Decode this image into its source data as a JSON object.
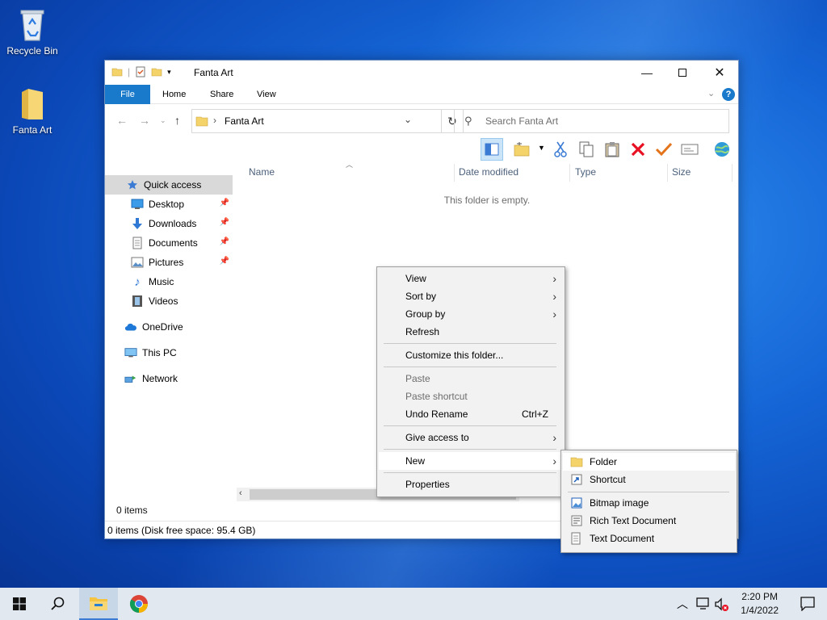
{
  "desktop": {
    "icons": [
      {
        "label": "Recycle Bin",
        "icon": "recycle-bin-icon"
      },
      {
        "label": "Fanta Art",
        "icon": "folder-icon"
      }
    ]
  },
  "window": {
    "title": "Fanta Art",
    "ribbon_tabs": [
      "File",
      "Home",
      "Share",
      "View"
    ],
    "address": {
      "path": "Fanta Art"
    },
    "search": {
      "placeholder": "Search Fanta Art"
    },
    "nav": {
      "quick_access": "Quick access",
      "items": [
        {
          "label": "Desktop",
          "pinned": true
        },
        {
          "label": "Downloads",
          "pinned": true
        },
        {
          "label": "Documents",
          "pinned": true
        },
        {
          "label": "Pictures",
          "pinned": true
        },
        {
          "label": "Music",
          "pinned": false
        },
        {
          "label": "Videos",
          "pinned": false
        }
      ],
      "onedrive": "OneDrive",
      "this_pc": "This PC",
      "network": "Network"
    },
    "columns": [
      "Name",
      "Date modified",
      "Type",
      "Size"
    ],
    "empty_message": "This folder is empty.",
    "item_count": "0 items",
    "status": "0 items (Disk free space: 95.4 GB)"
  },
  "context_menu": {
    "view": "View",
    "sort_by": "Sort by",
    "group_by": "Group by",
    "refresh": "Refresh",
    "customize": "Customize this folder...",
    "paste": "Paste",
    "paste_shortcut": "Paste shortcut",
    "undo_rename": "Undo Rename",
    "undo_shortcut": "Ctrl+Z",
    "give_access": "Give access to",
    "new": "New",
    "properties": "Properties"
  },
  "new_submenu": {
    "folder": "Folder",
    "shortcut": "Shortcut",
    "bitmap": "Bitmap image",
    "rtf": "Rich Text Document",
    "text": "Text Document"
  },
  "taskbar": {
    "time": "2:20 PM",
    "date": "1/4/2022"
  },
  "colors": {
    "accent": "#1979ca",
    "folder": "#f5d36b",
    "delete": "#e81123",
    "check": "#e3741c"
  }
}
